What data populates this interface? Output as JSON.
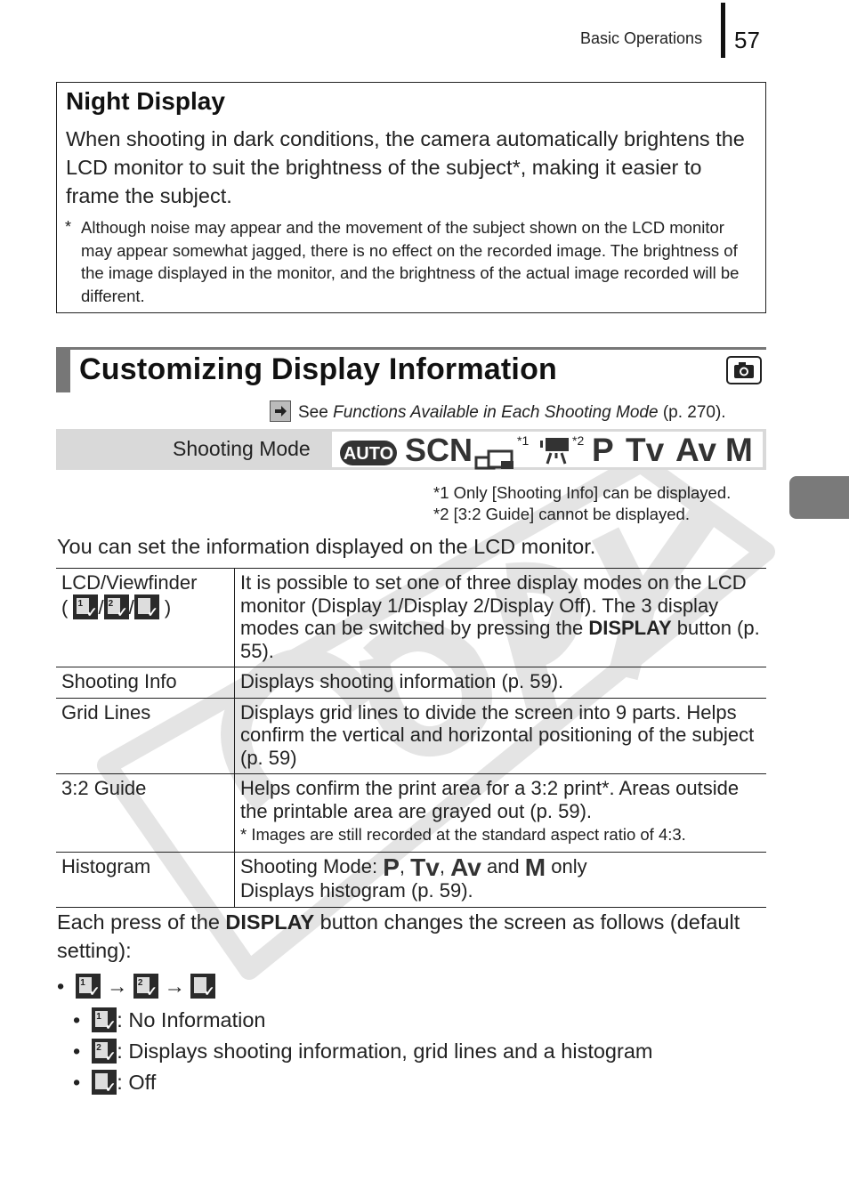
{
  "header": {
    "section": "Basic Operations",
    "page_number": "57"
  },
  "night_display": {
    "title": "Night Display",
    "body": "When shooting in dark conditions, the camera automatically brightens the LCD monitor to suit the brightness of the subject*, making it easier to frame the subject.",
    "footnote_marker": "*",
    "footnote": "Although noise may appear and the movement of the subject shown on the LCD monitor may appear somewhat jagged, there is no effect on the recorded image. The brightness of the image displayed in the monitor, and the brightness of the actual image recorded will be different."
  },
  "section": {
    "title": "Customizing Display Information",
    "mode_icon": "camera-icon",
    "see_prefix": "See ",
    "see_link": "Functions Available in Each Shooting Mode",
    "see_suffix": " (p. 270)."
  },
  "shooting_mode": {
    "label": "Shooting Mode",
    "modes": [
      {
        "icon": "auto-icon",
        "text": "AUTO"
      },
      {
        "icon": "scn-icon",
        "text": "SCN"
      },
      {
        "icon": "continuous-shooting-icon",
        "sup": "*1"
      },
      {
        "icon": "movie-icon",
        "sup": "*2"
      },
      {
        "icon": "program-icon",
        "text": "P"
      },
      {
        "icon": "shutter-priority-icon",
        "text": "Tv"
      },
      {
        "icon": "aperture-priority-icon",
        "text": "Av"
      },
      {
        "icon": "manual-icon",
        "text": "M"
      }
    ],
    "notes": [
      "*1 Only [Shooting Info] can be displayed.",
      "*2 [3:2 Guide] cannot be displayed."
    ]
  },
  "intro": "You can set the information displayed on the LCD monitor.",
  "table": {
    "rows": [
      {
        "name": "LCD/Viewfinder",
        "icons_open": "(",
        "icons_close": ")",
        "sep": "/",
        "desc_pre": "It is possible to set one of three display modes on the LCD monitor (Display 1/Display 2/Display Off). The 3 display modes can be switched by pressing the ",
        "desc_bold": "DISPLAY",
        "desc_post": " button (p. 55)."
      },
      {
        "name": "Shooting Info",
        "desc": "Displays shooting information (p. 59)."
      },
      {
        "name": "Grid Lines",
        "desc": "Displays grid lines to divide the screen into 9 parts. Helps confirm the vertical and horizontal positioning of the subject (p. 59)"
      },
      {
        "name": "3:2 Guide",
        "desc": "Helps confirm the print area for a 3:2 print*. Areas outside the printable area are grayed out (p. 59).",
        "note": "*  Images are still recorded at the standard aspect ratio of 4:3."
      },
      {
        "name": "Histogram",
        "desc_pre": "Shooting Mode: ",
        "mode_p": "P",
        "comma": ", ",
        "mode_tv": "Tv",
        "mode_av": "Av",
        "and": " and ",
        "mode_m": "M",
        "only": " only",
        "desc": "Displays histogram (p. 59)."
      }
    ]
  },
  "press": {
    "pre": "Each press of the ",
    "bold": "DISPLAY",
    "post": " button changes the screen as follows (default setting):"
  },
  "sequence": {
    "bullet": "•",
    "arrow": "→",
    "items": [
      {
        "icon": "display-1-icon",
        "num": "1",
        "label": ": No Information"
      },
      {
        "icon": "display-2-icon",
        "num": "2",
        "label": ": Displays shooting information, grid lines and a histogram"
      },
      {
        "icon": "display-off-icon",
        "num": "",
        "label": ": Off"
      }
    ]
  },
  "watermark": "COPY"
}
